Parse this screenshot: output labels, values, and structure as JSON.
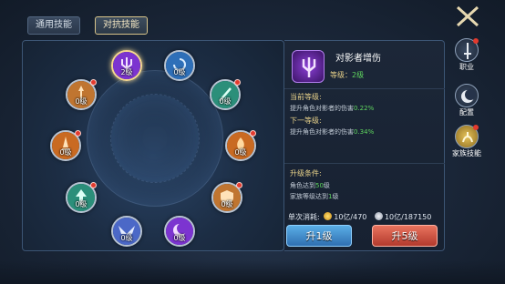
{
  "tabs": {
    "general": "通用技能",
    "versus": "对抗技能"
  },
  "skills": [
    {
      "level": "2级",
      "color": "#7c34d0",
      "icon": "trident-icon"
    },
    {
      "level": "0级",
      "color": "#2e6fb8",
      "icon": "swirl-icon"
    },
    {
      "level": "0级",
      "color": "#2b8f7a",
      "icon": "slash-icon"
    },
    {
      "level": "0级",
      "color": "#c96a22",
      "icon": "flame-icon"
    },
    {
      "level": "0级",
      "color": "#c07530",
      "icon": "shield-icon"
    },
    {
      "level": "0级",
      "color": "#7c34d0",
      "icon": "moon-icon"
    },
    {
      "level": "0级",
      "color": "#4b68c7",
      "icon": "wings-icon"
    },
    {
      "level": "0级",
      "color": "#2b8f7a",
      "icon": "arrow-icon"
    },
    {
      "level": "0级",
      "color": "#c96a22",
      "icon": "blade-icon"
    },
    {
      "level": "0级",
      "color": "#c07530",
      "icon": "spear-icon"
    }
  ],
  "detail": {
    "name": "对影者增伤",
    "level_label": "等级：",
    "level_value": "2级",
    "current_title": "当前等级:",
    "current_text_a": "提升角色对影者的伤害",
    "current_value": "0.22%",
    "next_title": "下一等级:",
    "next_text_a": "提升角色对影者的伤害",
    "next_value": "0.34%",
    "req_title": "升级条件:",
    "req_1a": "角色达到",
    "req_1b": "50",
    "req_1c": "级",
    "req_2a": "家族等级达到",
    "req_2b": "1",
    "req_2c": "级",
    "cost_label": "单次消耗:",
    "cost_gold": "10亿/470",
    "cost_silver": "10亿/187150"
  },
  "buttons": {
    "up1": "升1级",
    "up5": "升5级"
  },
  "side": {
    "job": "职业",
    "config": "配置",
    "family": "家族技能"
  },
  "colors": {
    "gold": "#e8d28a",
    "green": "#5fd65f",
    "blue_btn": "#3f8fd0",
    "red_btn": "#d0503f"
  }
}
